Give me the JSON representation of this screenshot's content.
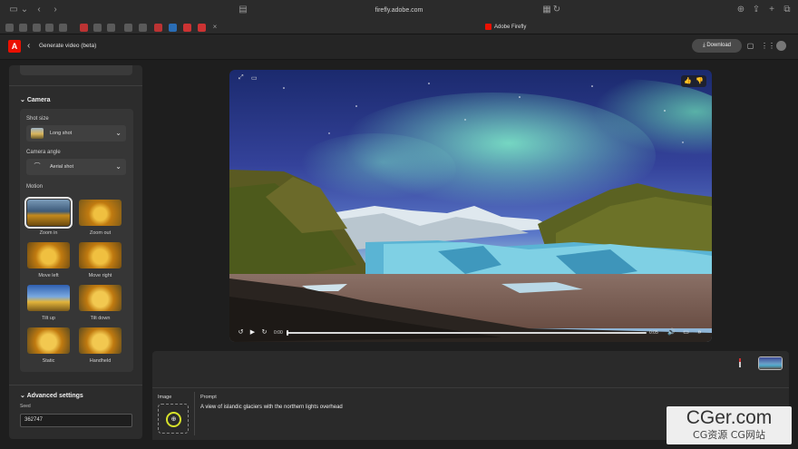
{
  "browser": {
    "url": "firefly.adobe.com",
    "active_tab_title": "Adobe Firefly"
  },
  "header": {
    "title": "Generate video (beta)",
    "download_label": "Download"
  },
  "camera": {
    "section_title": "Camera",
    "shot_size_label": "Shot size",
    "shot_size_value": "Long shot",
    "camera_angle_label": "Camera angle",
    "camera_angle_value": "Aerial shot",
    "motion_label": "Motion",
    "motions": [
      {
        "label": "Zoom in",
        "selected": true
      },
      {
        "label": "Zoom out",
        "selected": false
      },
      {
        "label": "Move left",
        "selected": false
      },
      {
        "label": "Move right",
        "selected": false
      },
      {
        "label": "Tilt up",
        "selected": false
      },
      {
        "label": "Tilt down",
        "selected": false
      },
      {
        "label": "Static",
        "selected": false
      },
      {
        "label": "Handheld",
        "selected": false
      }
    ]
  },
  "advanced": {
    "section_title": "Advanced settings",
    "seed_label": "Seed",
    "seed_value": "362747"
  },
  "player": {
    "time_current": "0:00",
    "time_total": "0:05",
    "progress_fraction": 0.0
  },
  "prompt": {
    "image_label": "Image",
    "prompt_label": "Prompt",
    "prompt_text": "A view of islandic glaciers with the northern lights overhead"
  },
  "watermark": {
    "main": "CGer.com",
    "sub": "CG资源 CG网站"
  },
  "colors": {
    "accent_adobe": "#eb1000",
    "image_slot_ring": "#d7e22a"
  }
}
